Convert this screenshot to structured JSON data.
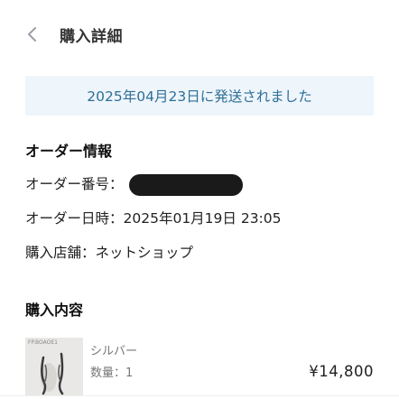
{
  "header": {
    "back_icon": "chevron-left-icon",
    "title": "購入詳細"
  },
  "banner": {
    "text": "2025年04月23日に発送されました",
    "background": "#eef5fb",
    "text_color": "#2f6f97"
  },
  "order_info": {
    "heading": "オーダー情報",
    "number_label": "オーダー番号：",
    "number_value": "[redacted]",
    "date_label": "オーダー日時：",
    "date_value": "2025年01月19日 23:05",
    "shop_label": "購入店舗：",
    "shop_value": "ネットショップ"
  },
  "contents": {
    "heading": "購入内容",
    "item": {
      "image_label": "FP.BOAOE1",
      "color": "シルバー",
      "quantity": "数量：1",
      "price": "¥14,800"
    }
  }
}
